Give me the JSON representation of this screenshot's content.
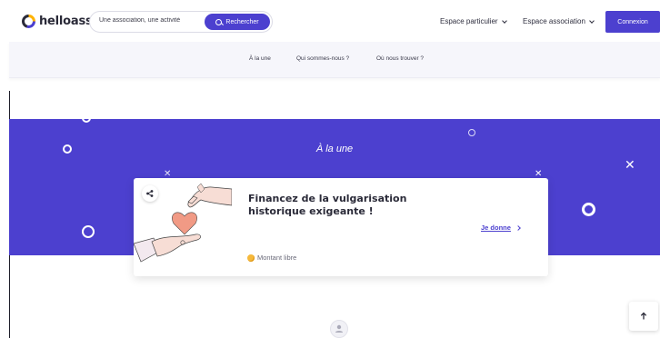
{
  "header": {
    "logo_text": "helloasso",
    "search_placeholder": "Une association, une activité",
    "search_button": "Rechercher",
    "nav_particulier": "Espace particulier",
    "nav_association": "Espace association",
    "login_button": "Connexion"
  },
  "subnav": {
    "items": [
      {
        "label": "À la une"
      },
      {
        "label": "Qui sommes-nous ?"
      },
      {
        "label": "Où nous trouver ?"
      }
    ]
  },
  "banner": {
    "title": "À la une"
  },
  "card": {
    "title": "Financez de la vulgarisation historique exigeante !",
    "cta": "Je donne",
    "amount_label": "Montant libre"
  },
  "colors": {
    "brand": "#4c40cf",
    "coin": "#f6b93b"
  },
  "icons": [
    "search-icon",
    "chevron-down-icon",
    "share-icon",
    "chevron-right-icon",
    "coin-icon",
    "arrow-up-icon",
    "user-icon"
  ]
}
